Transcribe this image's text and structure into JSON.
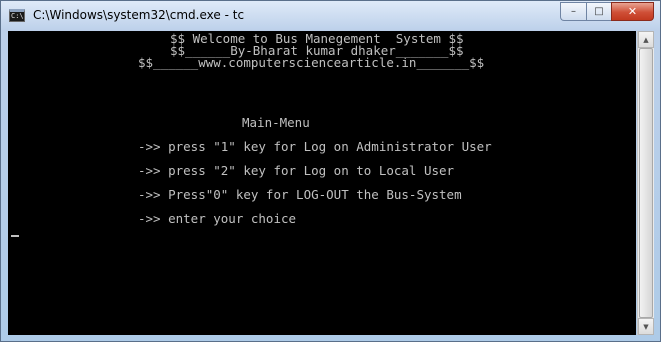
{
  "window": {
    "title": "C:\\Windows\\system32\\cmd.exe - tc",
    "icon": "cmd-icon",
    "icon_text": "C:\\",
    "controls": {
      "minimize": "–",
      "maximize": "□",
      "close": "✕"
    }
  },
  "console": {
    "lines": [
      "$$ Welcome to Bus Manegement  System $$",
      "$$______By-Bharat kumar dhaker_______$$",
      "$$______www.computersciencearticle.in_______$$",
      "Main-Menu",
      "->> press \"1\" key for Log on Administrator User",
      "->> press \"2\" key for Log on to Local User",
      "->> Press\"0\" key for LOG-OUT the Bus-System",
      "->> enter your choice"
    ]
  },
  "scrollbar": {
    "up": "▲",
    "down": "▼"
  },
  "colors": {
    "console_bg": "#000000",
    "console_text": "#c0c0c0",
    "close_button": "#c94a33"
  }
}
